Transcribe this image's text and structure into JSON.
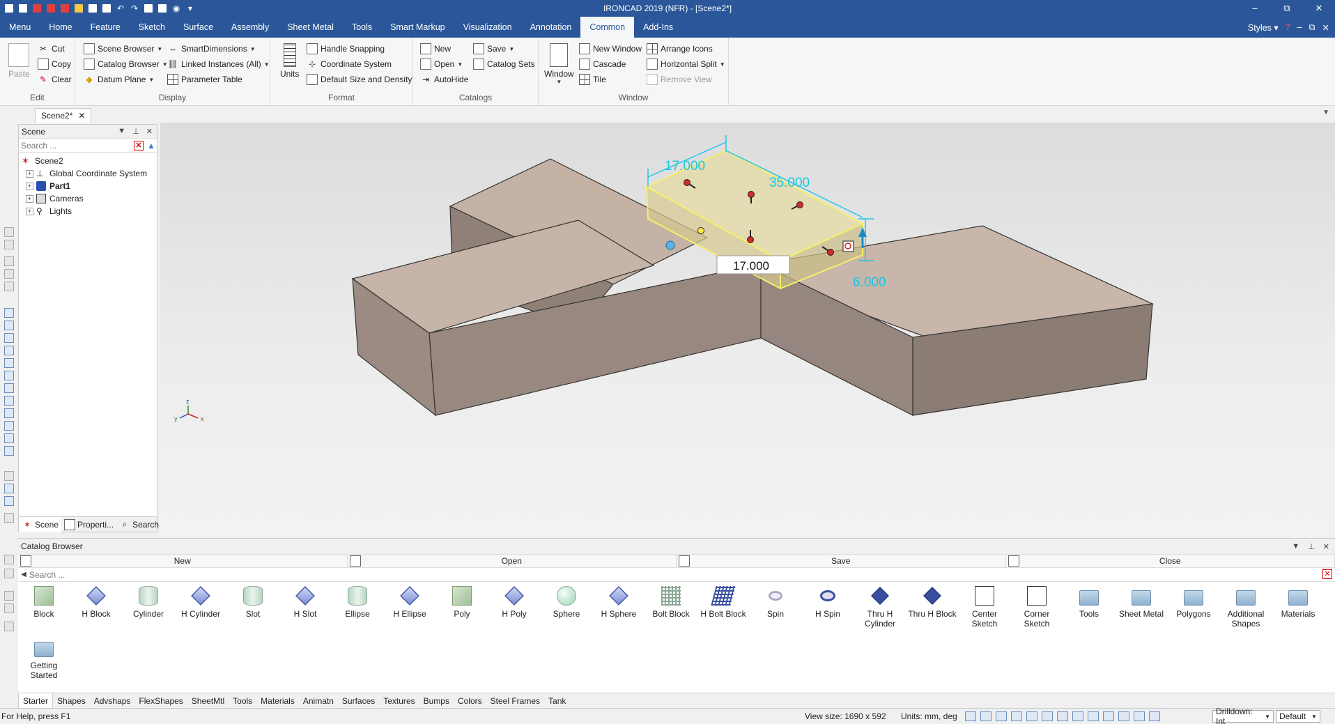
{
  "window": {
    "title": "IRONCAD 2019 (NFR) - [Scene2*]",
    "controls": [
      "–",
      "⧉",
      "✕"
    ]
  },
  "ribbon_tabs": [
    "Menu",
    "Home",
    "Feature",
    "Sketch",
    "Surface",
    "Assembly",
    "Sheet Metal",
    "Tools",
    "Smart Markup",
    "Visualization",
    "Annotation",
    "Common",
    "Add-Ins"
  ],
  "active_tab": "Common",
  "ribbon_right": {
    "styles": "Styles"
  },
  "groups": {
    "edit": {
      "label": "Edit",
      "paste": "Paste",
      "cut": "Cut",
      "copy": "Copy",
      "clear": "Clear"
    },
    "display": {
      "label": "Display",
      "scene_browser": "Scene Browser",
      "catalog_browser": "Catalog Browser",
      "datum_plane": "Datum Plane",
      "smart_dimensions": "SmartDimensions",
      "linked_instances": "Linked Instances (All)",
      "parameter_table": "Parameter Table"
    },
    "format": {
      "label": "Format",
      "units": "Units",
      "handle_snapping": "Handle Snapping",
      "coordinate_system": "Coordinate System",
      "default_size": "Default Size and Density"
    },
    "catalogs": {
      "label": "Catalogs",
      "new": "New",
      "open": "Open",
      "autohide": "AutoHide",
      "save": "Save",
      "catalog_sets": "Catalog Sets"
    },
    "window": {
      "label": "Window",
      "window": "Window",
      "new_window": "New Window",
      "cascade": "Cascade",
      "tile": "Tile",
      "arrange_icons": "Arrange Icons",
      "horizontal_split": "Horizontal Split",
      "remove_view": "Remove View"
    }
  },
  "doc_tab": "Scene2*",
  "scene_panel": {
    "title": "Scene",
    "search_placeholder": "Search ...",
    "tree": [
      {
        "label": "Scene2",
        "root": true
      },
      {
        "label": "Global Coordinate System"
      },
      {
        "label": "Part1",
        "bold": true
      },
      {
        "label": "Cameras"
      },
      {
        "label": "Lights"
      }
    ],
    "tabs": [
      "Scene",
      "Properti...",
      "Search"
    ]
  },
  "viewport": {
    "dims": {
      "d1": "17.000",
      "d2": "35.000",
      "d3": "6.000",
      "edit": "17.000"
    },
    "axes": {
      "x": "x",
      "y": "y",
      "z": "z"
    }
  },
  "catalog": {
    "title": "Catalog Browser",
    "toolbar": [
      "New",
      "Open",
      "Save",
      "Close"
    ],
    "search_placeholder": "Search ...",
    "items": [
      {
        "label": "Block",
        "icon": "block"
      },
      {
        "label": "H Block",
        "icon": "hollow"
      },
      {
        "label": "Cylinder",
        "icon": "cyl"
      },
      {
        "label": "H Cylinder",
        "icon": "hollow"
      },
      {
        "label": "Slot",
        "icon": "cyl"
      },
      {
        "label": "H Slot",
        "icon": "hollow"
      },
      {
        "label": "Ellipse",
        "icon": "cyl"
      },
      {
        "label": "H Ellipse",
        "icon": "hollow"
      },
      {
        "label": "Poly",
        "icon": "block"
      },
      {
        "label": "H Poly",
        "icon": "hollow"
      },
      {
        "label": "Sphere",
        "icon": "sphere"
      },
      {
        "label": "H Sphere",
        "icon": "hollow"
      },
      {
        "label": "Bolt Block",
        "icon": "grid"
      },
      {
        "label": "H Bolt Block",
        "icon": "hgrid"
      },
      {
        "label": "Spin",
        "icon": "spin"
      },
      {
        "label": "H Spin",
        "icon": "hspin"
      },
      {
        "label": "Thru H Cylinder",
        "icon": "thru"
      },
      {
        "label": "Thru H Block",
        "icon": "thru"
      },
      {
        "label": "Center Sketch",
        "icon": "sketch"
      },
      {
        "label": "Corner Sketch",
        "icon": "sketch"
      },
      {
        "label": "Tools",
        "icon": "folder"
      },
      {
        "label": "Sheet Metal",
        "icon": "folder"
      },
      {
        "label": "Polygons",
        "icon": "folder"
      },
      {
        "label": "Additional Shapes",
        "icon": "folder"
      },
      {
        "label": "Materials",
        "icon": "folder"
      },
      {
        "label": "Getting Started",
        "icon": "folder"
      }
    ],
    "tabs": [
      "Starter",
      "Shapes",
      "Advshaps",
      "FlexShapes",
      "SheetMtl",
      "Tools",
      "Materials",
      "Animatn",
      "Surfaces",
      "Textures",
      "Bumps",
      "Colors",
      "Steel Frames",
      "Tank"
    ]
  },
  "status": {
    "help": "For Help, press F1",
    "view_size": "View size: 1690 x 592",
    "units": "Units: mm, deg",
    "drilldown": "Drilldown: Int",
    "style": "Default"
  }
}
